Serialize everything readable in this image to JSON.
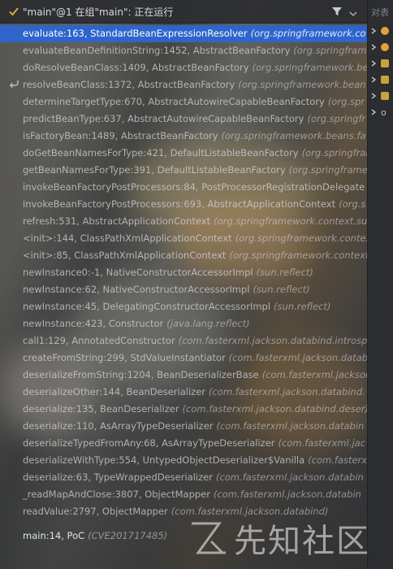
{
  "header": {
    "thread_title": "\"main\"@1 在组\"main\": 正在运行",
    "icons": [
      "check-icon",
      "filter-icon",
      "chevron-down-icon"
    ]
  },
  "frames": [
    {
      "method": "evaluate:163, StandardBeanExpressionResolver",
      "pkg": "(org.springframework.co"
    },
    {
      "method": "evaluateBeanDefinitionString:1452, AbstractBeanFactory",
      "pkg": "(org.springframew"
    },
    {
      "method": "doResolveBeanClass:1409, AbstractBeanFactory",
      "pkg": "(org.springframework.be"
    },
    {
      "method": "resolveBeanClass:1372, AbstractBeanFactory",
      "pkg": "(org.springframework.bean"
    },
    {
      "method": "determineTargetType:670, AbstractAutowireCapableBeanFactory",
      "pkg": "(org.spr"
    },
    {
      "method": "predictBeanType:637, AbstractAutowireCapableBeanFactory",
      "pkg": "(org.springfr"
    },
    {
      "method": "isFactoryBean:1489, AbstractBeanFactory",
      "pkg": "(org.springframework.beans.fa"
    },
    {
      "method": "doGetBeanNamesForType:421, DefaultListableBeanFactory",
      "pkg": "(org.springfram"
    },
    {
      "method": "getBeanNamesForType:391, DefaultListableBeanFactory",
      "pkg": "(org.springframew"
    },
    {
      "method": "invokeBeanFactoryPostProcessors:84, PostProcessorRegistrationDelegate",
      "pkg": ""
    },
    {
      "method": "invokeBeanFactoryPostProcessors:693, AbstractApplicationContext",
      "pkg": "(org.s"
    },
    {
      "method": "refresh:531, AbstractApplicationContext",
      "pkg": "(org.springframework.context.su"
    },
    {
      "method": "<init>:144, ClassPathXmlApplicationContext",
      "pkg": "(org.springframework.contex"
    },
    {
      "method": "<init>:85, ClassPathXmlApplicationContext",
      "pkg": "(org.springframework.context"
    },
    {
      "method": "newInstance0:-1, NativeConstructorAccessorImpl",
      "pkg": "(sun.reflect)"
    },
    {
      "method": "newInstance:62, NativeConstructorAccessorImpl",
      "pkg": "(sun.reflect)"
    },
    {
      "method": "newInstance:45, DelegatingConstructorAccessorImpl",
      "pkg": "(sun.reflect)"
    },
    {
      "method": "newInstance:423, Constructor",
      "pkg": "(java.lang.reflect)"
    },
    {
      "method": "call1:129, AnnotatedConstructor",
      "pkg": "(com.fasterxml.jackson.databind.introsp"
    },
    {
      "method": "createFromString:299, StdValueInstantiator",
      "pkg": "(com.fasterxml.jackson.databi"
    },
    {
      "method": "deserializeFromString:1204, BeanDeserializerBase",
      "pkg": "(com.fasterxml.jackson"
    },
    {
      "method": "deserializeOther:144, BeanDeserializer",
      "pkg": "(com.fasterxml.jackson.databind."
    },
    {
      "method": "deserialize:135, BeanDeserializer",
      "pkg": "(com.fasterxml.jackson.databind.deser)"
    },
    {
      "method": "deserialize:110, AsArrayTypeDeserializer",
      "pkg": "(com.fasterxml.jackson.databin"
    },
    {
      "method": "deserializeTypedFromAny:68, AsArrayTypeDeserializer",
      "pkg": "(com.fasterxml.jac"
    },
    {
      "method": "deserializeWithType:554, UntypedObjectDeserializer$Vanilla",
      "pkg": "(com.fasterx"
    },
    {
      "method": "deserialize:63, TypeWrappedDeserializer",
      "pkg": "(com.fasterxml.jackson.databin"
    },
    {
      "method": "_readMapAndClose:3807, ObjectMapper",
      "pkg": "(com.fasterxml.jackson.databin"
    },
    {
      "method": "readValue:2797, ObjectMapper",
      "pkg": "(com.fasterxml.jackson.databind)"
    },
    {
      "method": "main:14, PoC",
      "pkg": "(CVE201717485)"
    }
  ],
  "selected_index": 0,
  "side_panel": {
    "title": "对表",
    "rows": [
      {
        "label": "",
        "icon_color": "#e2a13a"
      },
      {
        "label": "",
        "icon_color": "#e2a13a"
      },
      {
        "label": "",
        "icon_color": "#c9a23a"
      },
      {
        "label": "",
        "icon_color": "#c9a23a"
      },
      {
        "label": "",
        "icon_color": "#c9a23a"
      },
      {
        "label": "o",
        "icon_color": ""
      }
    ]
  },
  "watermark": {
    "text": "先知社区",
    "icon": "watermark-logo-icon"
  },
  "colors": {
    "selection": "#2f65ca",
    "background": "#2b2d30",
    "check": "#e6a23c"
  }
}
